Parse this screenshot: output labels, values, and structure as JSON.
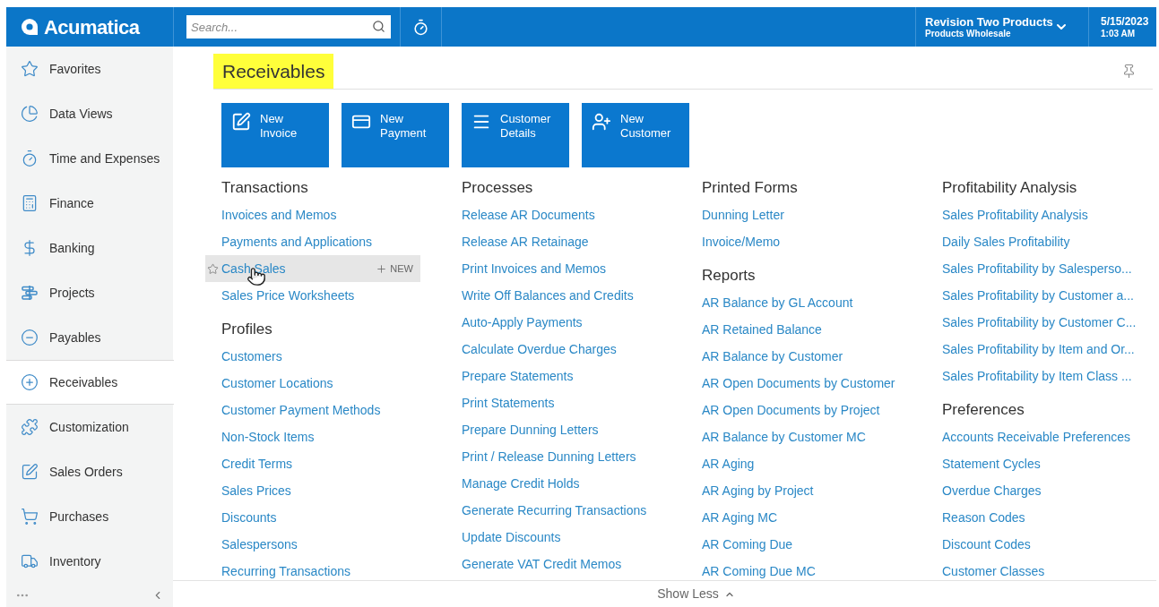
{
  "header": {
    "logo": "Acumatica",
    "search": {
      "placeholder": "Search..."
    },
    "company": {
      "name": "Revision Two Products",
      "branch": "Products Wholesale"
    },
    "date": "5/15/2023",
    "time": "1:03 AM"
  },
  "sidebar": {
    "items": [
      {
        "label": "Favorites",
        "selected": false
      },
      {
        "label": "Data Views",
        "selected": false
      },
      {
        "label": "Time and Expenses",
        "selected": false
      },
      {
        "label": "Finance",
        "selected": false
      },
      {
        "label": "Banking",
        "selected": false
      },
      {
        "label": "Projects",
        "selected": false
      },
      {
        "label": "Payables",
        "selected": false
      },
      {
        "label": "Receivables",
        "selected": true
      },
      {
        "label": "Customization",
        "selected": false
      },
      {
        "label": "Sales Orders",
        "selected": false
      },
      {
        "label": "Purchases",
        "selected": false
      },
      {
        "label": "Inventory",
        "selected": false
      }
    ]
  },
  "page": {
    "title": "Receivables",
    "quick_actions": [
      {
        "label": "New Invoice"
      },
      {
        "label": "New Payment"
      },
      {
        "label": "Customer Details"
      },
      {
        "label": "New Customer"
      }
    ],
    "columns": [
      {
        "sections": [
          {
            "title": "Transactions",
            "links": [
              {
                "label": "Invoices and Memos",
                "highlighted": false
              },
              {
                "label": "Payments and Applications",
                "highlighted": false
              },
              {
                "label": "Cash Sales",
                "highlighted": true,
                "action": "NEW"
              },
              {
                "label": "Sales Price Worksheets",
                "highlighted": false
              }
            ]
          },
          {
            "title": "Profiles",
            "links": [
              {
                "label": "Customers",
                "highlighted": false
              },
              {
                "label": "Customer Locations",
                "highlighted": false
              },
              {
                "label": "Customer Payment Methods",
                "highlighted": false
              },
              {
                "label": "Non-Stock Items",
                "highlighted": false
              },
              {
                "label": "Credit Terms",
                "highlighted": false
              },
              {
                "label": "Sales Prices",
                "highlighted": false
              },
              {
                "label": "Discounts",
                "highlighted": false
              },
              {
                "label": "Salespersons",
                "highlighted": false
              },
              {
                "label": "Recurring Transactions",
                "highlighted": false
              }
            ]
          }
        ]
      },
      {
        "sections": [
          {
            "title": "Processes",
            "links": [
              {
                "label": "Release AR Documents",
                "highlighted": false
              },
              {
                "label": "Release AR Retainage",
                "highlighted": false
              },
              {
                "label": "Print Invoices and Memos",
                "highlighted": false
              },
              {
                "label": "Write Off Balances and Credits",
                "highlighted": false
              },
              {
                "label": "Auto-Apply Payments",
                "highlighted": false
              },
              {
                "label": "Calculate Overdue Charges",
                "highlighted": false
              },
              {
                "label": "Prepare Statements",
                "highlighted": false
              },
              {
                "label": "Print Statements",
                "highlighted": false
              },
              {
                "label": "Prepare Dunning Letters",
                "highlighted": false
              },
              {
                "label": "Print / Release Dunning Letters",
                "highlighted": false
              },
              {
                "label": "Manage Credit Holds",
                "highlighted": false
              },
              {
                "label": "Generate Recurring Transactions",
                "highlighted": false
              },
              {
                "label": "Update Discounts",
                "highlighted": false
              },
              {
                "label": "Generate VAT Credit Memos",
                "highlighted": false
              }
            ]
          }
        ]
      },
      {
        "sections": [
          {
            "title": "Printed Forms",
            "links": [
              {
                "label": "Dunning Letter",
                "highlighted": false
              },
              {
                "label": "Invoice/Memo",
                "highlighted": false
              }
            ]
          },
          {
            "title": "Reports",
            "links": [
              {
                "label": "AR Balance by GL Account",
                "highlighted": false
              },
              {
                "label": "AR Retained Balance",
                "highlighted": false
              },
              {
                "label": "AR Balance by Customer",
                "highlighted": false
              },
              {
                "label": "AR Open Documents by Customer",
                "highlighted": false
              },
              {
                "label": "AR Open Documents by Project",
                "highlighted": false
              },
              {
                "label": "AR Balance by Customer MC",
                "highlighted": false
              },
              {
                "label": "AR Aging",
                "highlighted": false
              },
              {
                "label": "AR Aging by Project",
                "highlighted": false
              },
              {
                "label": "AR Aging MC",
                "highlighted": false
              },
              {
                "label": "AR Coming Due",
                "highlighted": false
              },
              {
                "label": "AR Coming Due MC",
                "highlighted": false
              }
            ]
          }
        ]
      },
      {
        "sections": [
          {
            "title": "Profitability Analysis",
            "links": [
              {
                "label": "Sales Profitability Analysis",
                "highlighted": false
              },
              {
                "label": "Daily Sales Profitability",
                "highlighted": false
              },
              {
                "label": "Sales Profitability by Salesperso...",
                "highlighted": false
              },
              {
                "label": "Sales Profitability by Customer a...",
                "highlighted": false
              },
              {
                "label": "Sales Profitability by Customer C...",
                "highlighted": false
              },
              {
                "label": "Sales Profitability by Item and Or...",
                "highlighted": false
              },
              {
                "label": "Sales Profitability by Item Class ...",
                "highlighted": false
              }
            ]
          },
          {
            "title": "Preferences",
            "links": [
              {
                "label": "Accounts Receivable Preferences",
                "highlighted": false
              },
              {
                "label": "Statement Cycles",
                "highlighted": false
              },
              {
                "label": "Overdue Charges",
                "highlighted": false
              },
              {
                "label": "Reason Codes",
                "highlighted": false
              },
              {
                "label": "Discount Codes",
                "highlighted": false
              },
              {
                "label": "Customer Classes",
                "highlighted": false
              }
            ]
          }
        ]
      }
    ],
    "toggle": "Show Less"
  }
}
